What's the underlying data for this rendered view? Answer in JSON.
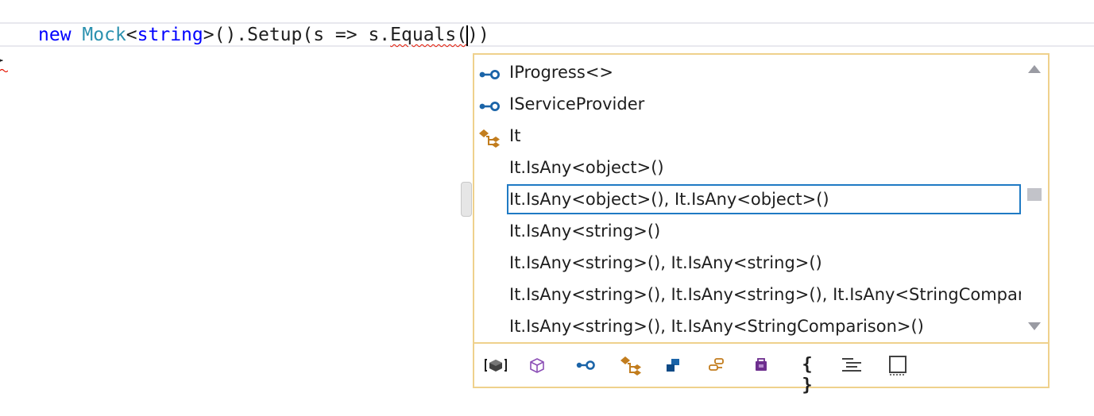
{
  "editor": {
    "code": {
      "kw_new": "new",
      "type_mock": "Mock",
      "lt": "<",
      "kw_string": "string",
      "after_generic": ">().Setup(s => s.",
      "method": "Equals",
      "open_paren": "(",
      "close_parens": "))"
    },
    "closing_brace": "}"
  },
  "completion": {
    "items": [
      {
        "label": "IProgress<>",
        "icon": "interface-icon"
      },
      {
        "label": "IServiceProvider",
        "icon": "interface-icon"
      },
      {
        "label": "It",
        "icon": "class-icon"
      },
      {
        "label": "It.IsAny<object>()",
        "icon": ""
      },
      {
        "label": "It.IsAny<object>(), It.IsAny<object>()",
        "icon": "",
        "selected": true
      },
      {
        "label": "It.IsAny<string>()",
        "icon": ""
      },
      {
        "label": "It.IsAny<string>(), It.IsAny<string>()",
        "icon": ""
      },
      {
        "label": "It.IsAny<string>(), It.IsAny<string>(), It.IsAny<StringComparis",
        "icon": ""
      },
      {
        "label": "It.IsAny<string>(), It.IsAny<StringComparison>()",
        "icon": ""
      }
    ],
    "filters": [
      "local-icon",
      "namespace-icon",
      "interface-icon",
      "class-icon",
      "struct-icon",
      "delegate-icon",
      "module-icon",
      "braces-icon",
      "snippet-icon",
      "target-type-icon"
    ],
    "filter_braces_label": "{ }"
  },
  "colors": {
    "accent_border": "#efd18c",
    "selection": "#1f7ac4",
    "keyword": "#0000ff",
    "type": "#2b91af",
    "interface_blue": "#1b64a8",
    "class_orange": "#c27d1e",
    "purple": "#6d2e8e"
  }
}
